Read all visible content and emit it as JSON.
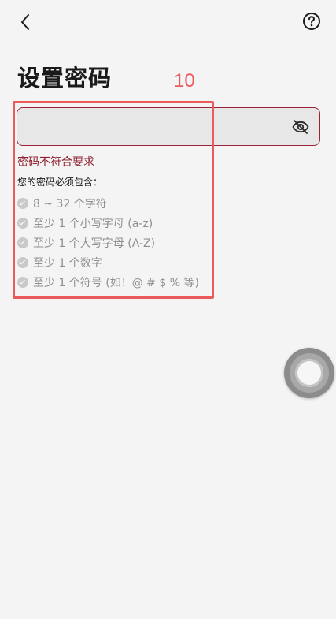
{
  "header": {
    "back_icon": "chevron-left-icon",
    "help_icon": "question-circle-icon"
  },
  "page": {
    "title": "设置密码"
  },
  "annotation": {
    "label": "10",
    "color": "#ec5b5b"
  },
  "password_field": {
    "value": "",
    "placeholder": "",
    "border_color": "#9b2335",
    "toggle_icon": "eye-off-icon"
  },
  "validation": {
    "error": "密码不符合要求",
    "heading": "您的密码必须包含：",
    "requirements": [
      "8 ~ 32 个字符",
      "至少 1 个小写字母 (a-z)",
      "至少 1 个大写字母 (A-Z)",
      "至少 1 个数字",
      "至少 1 个符号 (如！@ # $ % 等)"
    ]
  },
  "floating_button": {
    "icon": "assistive-touch-icon"
  }
}
